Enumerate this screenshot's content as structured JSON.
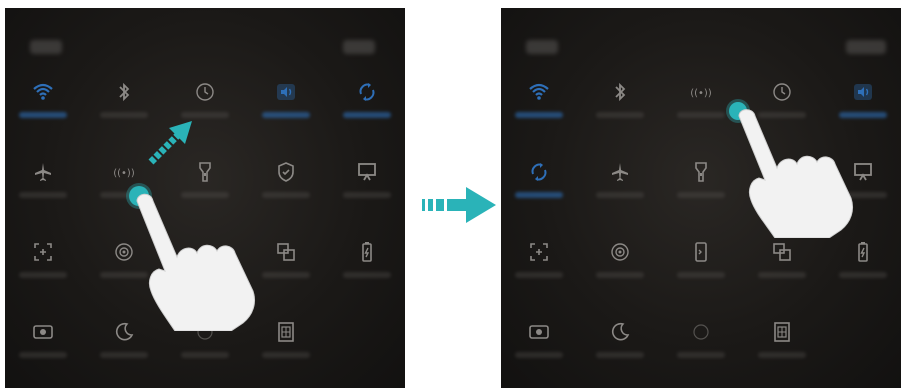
{
  "colors": {
    "accent": "#2e6fb8",
    "icon": "#8c8986",
    "pointer": "#2ab3b8",
    "hand": "#f2f2f2"
  },
  "left_panel": {
    "tiles": [
      {
        "icon": "wifi-icon",
        "active": true
      },
      {
        "icon": "bluetooth-icon",
        "active": false
      },
      {
        "icon": "clock-icon",
        "active": false
      },
      {
        "icon": "sound-icon",
        "active": true
      },
      {
        "icon": "rotation-icon",
        "active": true
      },
      {
        "icon": "airplane-icon",
        "active": false
      },
      {
        "icon": "nfc-icon",
        "active": false
      },
      {
        "icon": "flashlight-icon",
        "active": false
      },
      {
        "icon": "shield-icon",
        "active": false
      },
      {
        "icon": "screen-project-icon",
        "active": false
      },
      {
        "icon": "screenshot-icon",
        "active": false
      },
      {
        "icon": "hotspot-icon",
        "active": false
      },
      {
        "icon": "blank",
        "active": false
      },
      {
        "icon": "multiscreen-icon",
        "active": false
      },
      {
        "icon": "battery-saver-icon",
        "active": false
      },
      {
        "icon": "screen-record-icon",
        "active": false
      },
      {
        "icon": "moon-icon",
        "active": false
      },
      {
        "icon": "eye-comfort-icon",
        "active": false
      },
      {
        "icon": "sim-icon",
        "active": false
      }
    ]
  },
  "right_panel": {
    "tiles": [
      {
        "icon": "wifi-icon",
        "active": true
      },
      {
        "icon": "bluetooth-icon",
        "active": false
      },
      {
        "icon": "nfc-icon",
        "active": false
      },
      {
        "icon": "clock-icon",
        "active": false
      },
      {
        "icon": "sound-icon",
        "active": true
      },
      {
        "icon": "rotation-icon",
        "active": true
      },
      {
        "icon": "airplane-icon",
        "active": false
      },
      {
        "icon": "flashlight-icon",
        "active": false
      },
      {
        "icon": "blank",
        "active": false
      },
      {
        "icon": "screen-project-icon",
        "active": false
      },
      {
        "icon": "screenshot-icon",
        "active": false
      },
      {
        "icon": "hotspot-icon",
        "active": false
      },
      {
        "icon": "phone-icon",
        "active": false
      },
      {
        "icon": "multiscreen-icon",
        "active": false
      },
      {
        "icon": "battery-saver-icon",
        "active": false
      },
      {
        "icon": "screen-record-icon",
        "active": false
      },
      {
        "icon": "moon-icon",
        "active": false
      },
      {
        "icon": "eye-comfort-icon",
        "active": false
      },
      {
        "icon": "sim-icon",
        "active": false
      }
    ]
  },
  "transition_arrow": "arrow-right-icon"
}
